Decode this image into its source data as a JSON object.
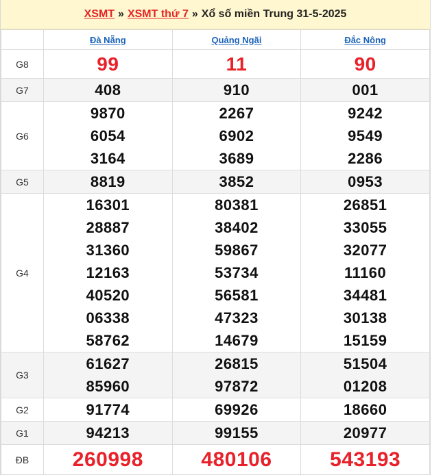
{
  "breadcrumb": {
    "link1": "XSMT",
    "sep1": "»",
    "link2": "XSMT thứ 7",
    "sep2": "»",
    "title": "Xổ số miền Trung 31-5-2025"
  },
  "provinces": [
    "Đà Nẵng",
    "Quảng Ngãi",
    "Đắc Nông"
  ],
  "prizes": [
    {
      "label": "G8",
      "values": [
        [
          "99"
        ],
        [
          "11"
        ],
        [
          "90"
        ]
      ]
    },
    {
      "label": "G7",
      "values": [
        [
          "408"
        ],
        [
          "910"
        ],
        [
          "001"
        ]
      ]
    },
    {
      "label": "G6",
      "values": [
        [
          "9870",
          "6054",
          "3164"
        ],
        [
          "2267",
          "6902",
          "3689"
        ],
        [
          "9242",
          "9549",
          "2286"
        ]
      ]
    },
    {
      "label": "G5",
      "values": [
        [
          "8819"
        ],
        [
          "3852"
        ],
        [
          "0953"
        ]
      ]
    },
    {
      "label": "G4",
      "values": [
        [
          "16301",
          "28887",
          "31360",
          "12163",
          "40520",
          "06338",
          "58762"
        ],
        [
          "80381",
          "38402",
          "59867",
          "53734",
          "56581",
          "47323",
          "14679"
        ],
        [
          "26851",
          "33055",
          "32077",
          "11160",
          "34481",
          "30138",
          "15159"
        ]
      ]
    },
    {
      "label": "G3",
      "values": [
        [
          "61627",
          "85960"
        ],
        [
          "26815",
          "97872"
        ],
        [
          "51504",
          "01208"
        ]
      ]
    },
    {
      "label": "G2",
      "values": [
        [
          "91774"
        ],
        [
          "69926"
        ],
        [
          "18660"
        ]
      ]
    },
    {
      "label": "G1",
      "values": [
        [
          "94213"
        ],
        [
          "99155"
        ],
        [
          "20977"
        ]
      ]
    },
    {
      "label": "ĐB",
      "values": [
        [
          "260998"
        ],
        [
          "480106"
        ],
        [
          "543193"
        ]
      ]
    }
  ],
  "colors": {
    "accent_red": "#e8212a",
    "link_blue": "#1a62b8",
    "header_bg": "#fff7cf"
  }
}
